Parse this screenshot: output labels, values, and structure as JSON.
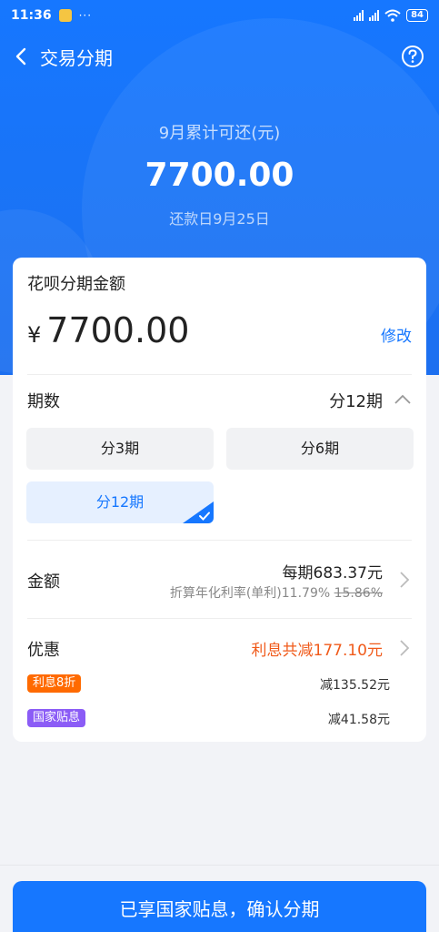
{
  "statusbar": {
    "time": "11:36",
    "dots": "···",
    "battery": "84",
    "signal1": "HD",
    "signal2": "HD"
  },
  "nav": {
    "title": "交易分期"
  },
  "summary": {
    "label": "9月累计可还(元)",
    "amount": "7700.00",
    "due_date": "还款日9月25日"
  },
  "card": {
    "title": "花呗分期金额",
    "currency": "¥",
    "amount": "7700.00",
    "edit": "修改",
    "period_label": "期数",
    "period_current": "分12期",
    "options": [
      {
        "label": "分3期",
        "selected": false
      },
      {
        "label": "分6期",
        "selected": false
      },
      {
        "label": "分12期",
        "selected": true
      }
    ],
    "amount_label": "金额",
    "per_period": "每期683.37元",
    "rate_prefix": "折算年化利率(单利)11.79%",
    "rate_original": "15.86%",
    "discount_label": "优惠",
    "discount_total": "利息共减177.10元",
    "discounts": [
      {
        "tag": "利息8折",
        "value": "减135.52元",
        "color": "#ff6a00"
      },
      {
        "tag": "国家贴息",
        "value": "减41.58元",
        "color": "#8b5cf6"
      }
    ]
  },
  "confirm_button": "已享国家贴息，确认分期",
  "colors": {
    "primary": "#1677ff",
    "discount": "#f05a1a"
  }
}
